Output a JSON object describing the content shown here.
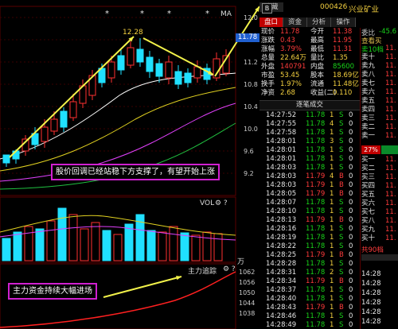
{
  "toolbar": {
    "collapse_label": "隐藏",
    "b_label": "B"
  },
  "stock": {
    "code": "000426",
    "name": "兴业矿业"
  },
  "tabs": [
    "盘口",
    "资金",
    "分析",
    "操作"
  ],
  "chart": {
    "high_label": "12.28",
    "price_ticks": [
      "12.0",
      "11.6",
      "11.2",
      "10.8",
      "10.4",
      "10.0",
      "9.6",
      "9.2"
    ],
    "current_price_badge": "11.78",
    "vol_label": "VOL",
    "wan_label": "万",
    "main_force_label": "主力追踪",
    "main_force_ticks": [
      "1062",
      "1056",
      "1050",
      "1044",
      "1038"
    ],
    "ma_label": "MA",
    "star": "*"
  },
  "annotations": {
    "support_text": "股价回调已经站稳下方支撑了，有望开始上涨",
    "capital_text": "主力资金持续大幅进场"
  },
  "quote": {
    "rows": [
      {
        "l1": "现价",
        "v1": "11.78",
        "l2": "今开",
        "v2": "11.38"
      },
      {
        "l1": "涨跌",
        "v1": "0.43",
        "l2": "最高",
        "v2": "11.95"
      },
      {
        "l1": "涨幅",
        "v1": "3.79%",
        "l2": "最低",
        "v2": "11.31"
      },
      {
        "l1": "总量",
        "v1": "22.64万",
        "l2": "量比",
        "v2": "1.35"
      },
      {
        "l1": "外盘",
        "v1": "140791",
        "l2": "内盘",
        "v2": "85600"
      },
      {
        "l1": "市盈",
        "v1": "53.45",
        "l2": "股本",
        "v2": "18.69亿"
      },
      {
        "l1": "换手",
        "v1": "1.97%",
        "l2": "流通",
        "v2": "11.48亿"
      },
      {
        "l1": "净资",
        "v1": "2.68",
        "l2": "收益(二)",
        "v2": "0.110"
      }
    ],
    "ticks_header": "逐笔成交"
  },
  "ticks": [
    {
      "t": "14:27:52",
      "p": "11.78",
      "v": "1",
      "d": "S"
    },
    {
      "t": "14:27:55",
      "p": "11.78",
      "v": "4",
      "d": "S"
    },
    {
      "t": "14:27:58",
      "p": "11.78",
      "v": "1",
      "d": "S"
    },
    {
      "t": "14:28:01",
      "p": "11.78",
      "v": "3",
      "d": "S"
    },
    {
      "t": "14:28:01",
      "p": "11.78",
      "v": "1",
      "d": "S"
    },
    {
      "t": "14:28:01",
      "p": "11.78",
      "v": "1",
      "d": "S"
    },
    {
      "t": "14:28:03",
      "p": "11.78",
      "v": "1",
      "d": "S"
    },
    {
      "t": "14:28:03",
      "p": "11.79",
      "v": "4",
      "d": "B"
    },
    {
      "t": "14:28:03",
      "p": "11.79",
      "v": "1",
      "d": "B"
    },
    {
      "t": "14:28:05",
      "p": "11.79",
      "v": "1",
      "d": "B"
    },
    {
      "t": "14:28:07",
      "p": "11.78",
      "v": "1",
      "d": "S"
    },
    {
      "t": "14:28:10",
      "p": "11.78",
      "v": "1",
      "d": "S"
    },
    {
      "t": "14:28:13",
      "p": "11.79",
      "v": "1",
      "d": "B"
    },
    {
      "t": "14:28:16",
      "p": "11.78",
      "v": "1",
      "d": "S"
    },
    {
      "t": "14:28:19",
      "p": "11.78",
      "v": "1",
      "d": "S"
    },
    {
      "t": "14:28:22",
      "p": "11.78",
      "v": "1",
      "d": "S"
    },
    {
      "t": "14:28:25",
      "p": "11.79",
      "v": "1",
      "d": "B"
    },
    {
      "t": "14:28:28",
      "p": "11.78",
      "v": "1",
      "d": "S"
    },
    {
      "t": "14:28:31",
      "p": "11.78",
      "v": "2",
      "d": "S"
    },
    {
      "t": "14:28:34",
      "p": "11.79",
      "v": "1",
      "d": "B"
    },
    {
      "t": "14:28:37",
      "p": "11.78",
      "v": "1",
      "d": "S"
    },
    {
      "t": "14:28:40",
      "p": "11.78",
      "v": "1",
      "d": "S"
    },
    {
      "t": "14:28:43",
      "p": "11.79",
      "v": "1",
      "d": "B"
    },
    {
      "t": "14:28:46",
      "p": "11.78",
      "v": "1",
      "d": "S"
    },
    {
      "t": "14:28:49",
      "p": "11.78",
      "v": "1",
      "d": "S"
    }
  ],
  "orderbook": {
    "weibi_label": "委比",
    "weibi_value": "-45.6",
    "view_label": "查看买",
    "sell_total_label": "卖10档",
    "sell_total_value": "11.",
    "sells": [
      "卖十",
      "卖九",
      "卖八",
      "卖七",
      "卖六",
      "卖五",
      "卖四",
      "卖三",
      "卖二",
      "卖一"
    ],
    "pct_badge": "27%",
    "buys": [
      "买一",
      "买二",
      "买三",
      "买四",
      "买五",
      "买六",
      "买七",
      "买八",
      "买九",
      "买十"
    ],
    "buy_total_label": "共90档",
    "bottom_times": [
      "14:28",
      "14:28",
      "14:28",
      "14:28",
      "14:28",
      "14:28"
    ]
  }
}
